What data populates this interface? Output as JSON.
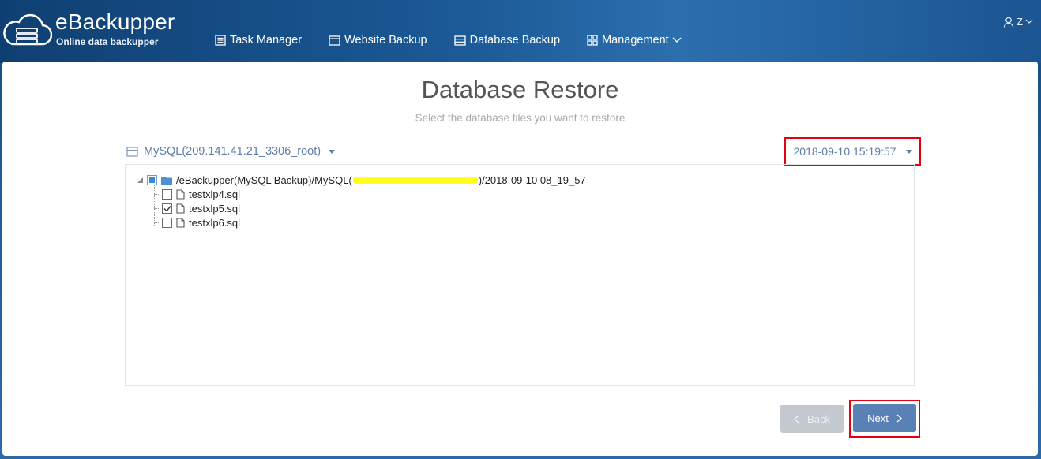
{
  "header": {
    "brand_title": "eBackupper",
    "brand_subtitle": "Online data backupper",
    "nav": [
      {
        "label": "Task Manager",
        "icon": "list-icon"
      },
      {
        "label": "Website Backup",
        "icon": "window-icon"
      },
      {
        "label": "Database Backup",
        "icon": "database-icon"
      },
      {
        "label": "Management",
        "icon": "grid-icon"
      }
    ],
    "user_label": "Z"
  },
  "main": {
    "title": "Database Restore",
    "subtitle": "Select the database files you want to restore",
    "db_selector": "MySQL(209.141.41.21_3306_root)",
    "date_selector": "2018-09-10 15:19:57",
    "tree": {
      "root": {
        "path_prefix": "/eBackupper(MySQL Backup)/MySQL(",
        "path_suffix": ")/2018-09-10 08_19_57",
        "checked": "partial"
      },
      "files": [
        {
          "name": "testxlp4.sql",
          "checked": false
        },
        {
          "name": "testxlp5.sql",
          "checked": true
        },
        {
          "name": "testxlp6.sql",
          "checked": false
        }
      ]
    },
    "back_label": "Back",
    "next_label": "Next"
  },
  "colors": {
    "header_accent": "#1c5a97",
    "link_blue": "#5d7ea6",
    "next_button": "#5a81b5",
    "back_button": "#c4c9d0",
    "highlight_box": "#e4000f",
    "redaction": "#ffff1a"
  }
}
